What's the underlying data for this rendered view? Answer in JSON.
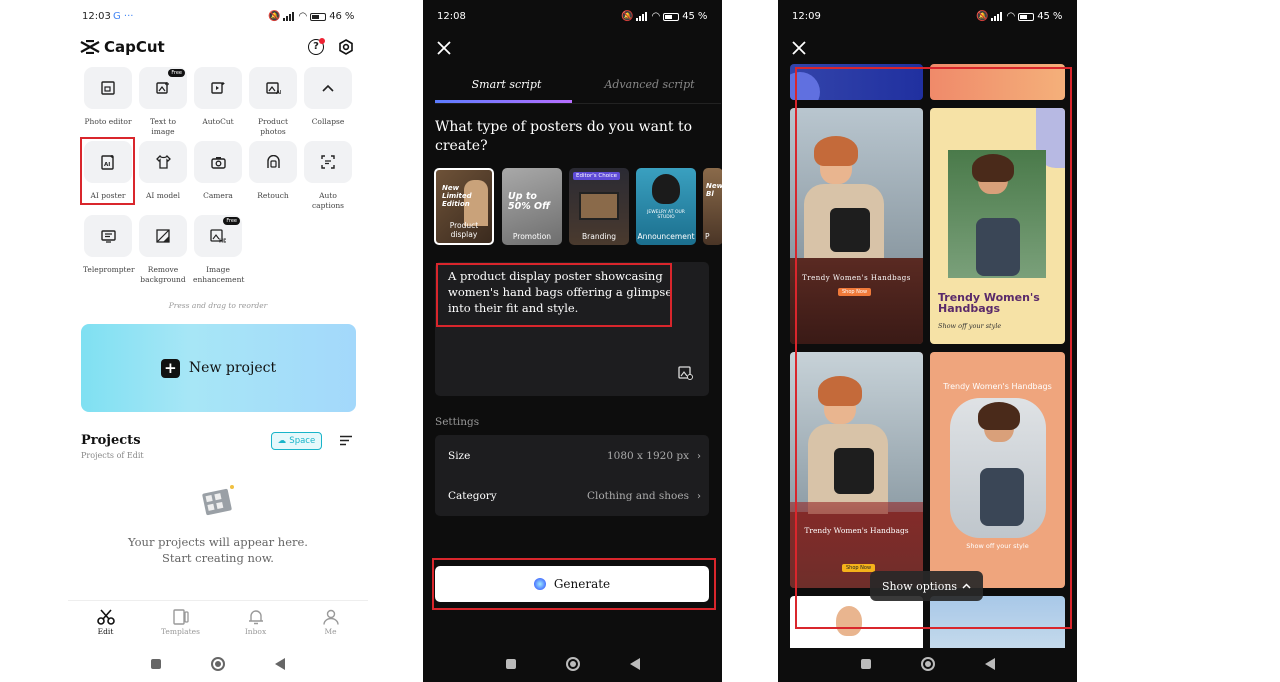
{
  "home": {
    "status_time": "12:03",
    "status_extra": "G ···",
    "battery": "46",
    "brand": "CapCut",
    "tools": [
      {
        "label": "Photo editor",
        "free": ""
      },
      {
        "label": "Text to image",
        "free": "Free"
      },
      {
        "label": "AutoCut",
        "free": ""
      },
      {
        "label": "Product photos",
        "free": ""
      },
      {
        "label": "Collapse",
        "free": ""
      },
      {
        "label": "AI poster",
        "free": ""
      },
      {
        "label": "AI model",
        "free": ""
      },
      {
        "label": "Camera",
        "free": ""
      },
      {
        "label": "Retouch",
        "free": ""
      },
      {
        "label": "Auto captions",
        "free": ""
      },
      {
        "label": "Teleprompter",
        "free": ""
      },
      {
        "label": "Remove background",
        "free": ""
      },
      {
        "label": "Image enhancement",
        "free": "Free"
      }
    ],
    "reorder_hint": "Press and drag to reorder",
    "new_project": "New project",
    "projects_title": "Projects",
    "projects_sub": "Projects of Edit",
    "space_label": "Space",
    "empty_line1": "Your projects will appear here.",
    "empty_line2": "Start creating now.",
    "nav": [
      "Edit",
      "Templates",
      "Inbox",
      "Me"
    ]
  },
  "poster": {
    "status_time": "12:08",
    "battery": "45",
    "tabs": [
      "Smart script",
      "Advanced script"
    ],
    "question": "What type of posters do you want to create?",
    "types": [
      {
        "label": "Product display",
        "overlay": "New Limited Edition"
      },
      {
        "label": "Promotion",
        "overlay": "Up to 50% Off"
      },
      {
        "label": "Branding",
        "overlay": "Editor's Choice"
      },
      {
        "label": "Announcement",
        "overlay": "JEWELRY AT OUR STUDIO"
      },
      {
        "label": "P",
        "overlay": "New Bl"
      }
    ],
    "prompt": "A product display poster showcasing women's hand bags offering a glimpse into their fit and style.",
    "settings_label": "Settings",
    "size_label": "Size",
    "size_value": "1080 x 1920 px",
    "category_label": "Category",
    "category_value": "Clothing and shoes",
    "generate": "Generate"
  },
  "results": {
    "status_time": "12:09",
    "battery": "45",
    "posters": [
      {
        "title": "Trendy Women's Handbags",
        "cta": "Shop Now",
        "sub": ""
      },
      {
        "title": "Trendy Women's Handbags",
        "cta": "",
        "sub": "Show off your style"
      },
      {
        "title": "Trendy Women's Handbags",
        "cta": "Shop Now",
        "sub": ""
      },
      {
        "title": "Trendy Women's Handbags",
        "cta": "",
        "sub": "Show off your style"
      }
    ],
    "show_options": "Show options"
  },
  "colors": {
    "highlight": "#d9262c",
    "accent_blue": "#5c7cff",
    "space_chip": "#19b4c9"
  }
}
